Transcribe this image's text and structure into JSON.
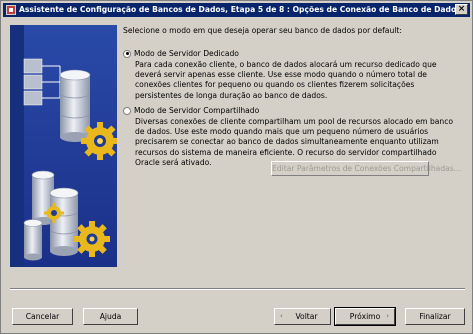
{
  "window": {
    "title": "Assistente de Configuração de Bancos de Dados, Etapa 5 de 8 : Opções de Conexão de Banco de Dados",
    "close_label": "×"
  },
  "content": {
    "prompt": "Selecione o modo em que deseja operar seu banco de dados por default:",
    "option_dedicated": {
      "label": "Modo de Servidor Dedicado",
      "selected": true,
      "description": "Para cada conexão cliente, o banco de dados alocará um recurso dedicado que deverá servir apenas esse cliente. Use esse modo quando o número total de conexões clientes for pequeno ou quando os clientes fizerem solicitações persistentes de longa duração ao banco de dados."
    },
    "option_shared": {
      "label": "Modo de Servidor Compartilhado",
      "selected": false,
      "description": "Diversas conexões de cliente compartilham um pool de recursos alocado em banco de dados. Use este modo quando mais que um pequeno número de usuários precisarem se conectar ao banco de dados simultaneamente enquanto utilizam recursos do sistema de maneira eficiente. O recurso do servidor compartilhado Oracle será ativado."
    },
    "edit_shared_button": "Editar Parâmetros de Conexões Compartilhadas..."
  },
  "footer": {
    "cancel": "Cancelar",
    "help": "Ajuda",
    "back": "Voltar",
    "next": "Próximo",
    "finish": "Finalizar"
  }
}
